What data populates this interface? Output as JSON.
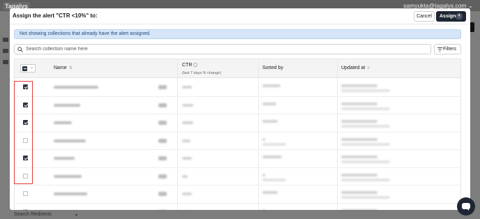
{
  "background": {
    "brand": "Tagalys",
    "user": "samyukta@tagalys.com ⌄",
    "footer_text": "Search Redirects",
    "footer_caret": "▾"
  },
  "modal": {
    "title": "Assign the alert \"CTR <10%\" to:",
    "cancel_label": "Cancel",
    "assign_label": "Assign",
    "assign_count": "4",
    "notice": "Not showing collections that already have the alert assigned.",
    "search_placeholder": "Search collection name here",
    "filters_label": "Filters"
  },
  "table": {
    "columns": {
      "name": "Name",
      "ctr": "CTR",
      "ctr_sub": "(last 7 days % change)",
      "sorted_by": "Sorted by",
      "updated_at": "Updated at"
    },
    "rows": [
      {
        "checked": true
      },
      {
        "checked": true
      },
      {
        "checked": true
      },
      {
        "checked": false
      },
      {
        "checked": true
      },
      {
        "checked": false
      },
      {
        "checked": false
      },
      {
        "checked": false
      }
    ]
  },
  "colors": {
    "accent_dark": "#1f2633",
    "notice_bg": "#d6e6f8",
    "highlight_red": "#e23a3a"
  },
  "icons": [
    "search-icon",
    "filter-icon",
    "chevron-down-icon",
    "info-icon",
    "sort-icon",
    "chat-icon"
  ]
}
